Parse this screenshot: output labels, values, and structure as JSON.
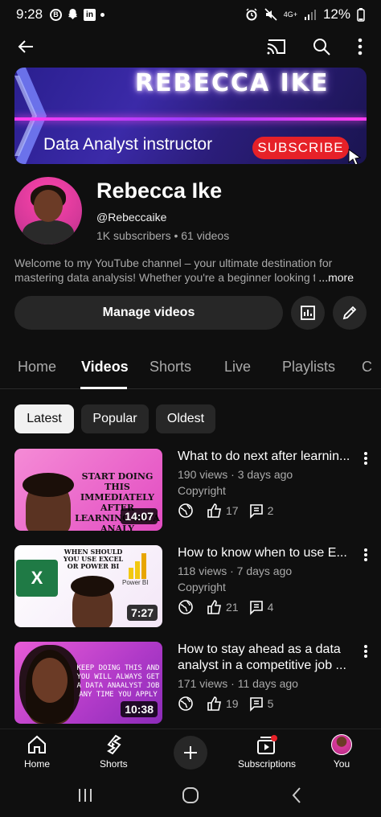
{
  "status_bar": {
    "time": "9:28",
    "signal_label": "4G+",
    "battery": "12%"
  },
  "banner": {
    "name": "REBECCA IKE",
    "tagline": "Data Analyst instructor",
    "subscribe_label": "SUBSCRIBE"
  },
  "channel": {
    "name": "Rebecca Ike",
    "handle": "@Rebeccaike",
    "stats": "1K subscribers • 61 videos",
    "description": "Welcome to my YouTube channel – your ultimate destination for mastering data analysis! Whether you're a beginner looking to",
    "more_label": "...more",
    "manage_label": "Manage videos"
  },
  "tabs": [
    "Home",
    "Videos",
    "Shorts",
    "Live",
    "Playlists",
    "C"
  ],
  "active_tab": "Videos",
  "chips": [
    "Latest",
    "Popular",
    "Oldest"
  ],
  "selected_chip": "Latest",
  "videos": [
    {
      "title": "What to do next after learnin...",
      "meta": "190 views · 3 days ago",
      "note": "Copyright",
      "likes": "17",
      "comments": "2",
      "duration": "14:07",
      "thumb_text": "START DOING THIS IMMEDIATELY AFTER LEARNING DATA ANALY"
    },
    {
      "title": "How to know when to use E...",
      "meta": "118 views · 7 days ago",
      "note": "Copyright",
      "likes": "21",
      "comments": "4",
      "duration": "7:27",
      "thumb_text": "WHEN SHOULD YOU USE EXCEL OR POWER BI",
      "thumb_logo_text": "Power BI"
    },
    {
      "title": "How to stay ahead as a data analyst in a competitive job ...",
      "meta": "171 views · 11 days ago",
      "likes": "19",
      "comments": "5",
      "duration": "10:38",
      "thumb_text": "KEEP DOING THIS AND YOU WILL ALWAYS GET A DATA ANAALYST JOB ANY TIME YOU APPLY"
    }
  ],
  "bottom_nav": {
    "home": "Home",
    "shorts": "Shorts",
    "subscriptions": "Subscriptions",
    "you": "You"
  },
  "colors": {
    "background": "#0f0f0f",
    "surface": "#272727",
    "accent_red": "#e62128",
    "secondary_text": "#aaaaaa"
  }
}
